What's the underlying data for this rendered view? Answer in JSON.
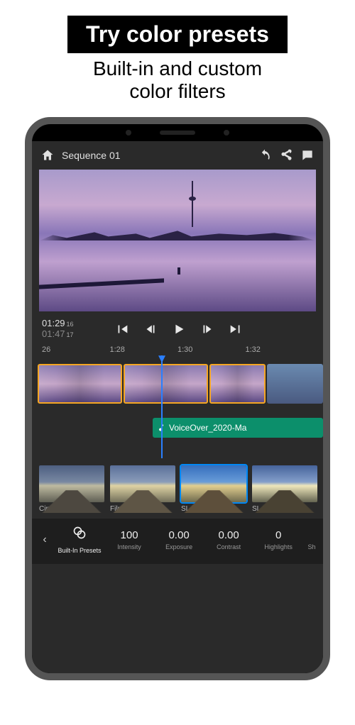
{
  "promo": {
    "title": "Try color presets",
    "subtitle_l1": "Built-in and custom",
    "subtitle_l2": "color filters"
  },
  "header": {
    "sequence": "Sequence 01"
  },
  "playback": {
    "time_in": "01:29",
    "time_in_frames": "16",
    "time_out": "01:47",
    "time_out_frames": "17"
  },
  "ruler": {
    "t0": "26",
    "t1": "1:28",
    "t2": "1:30",
    "t3": "1:32"
  },
  "audio": {
    "clip_name": "VoiceOver_2020-Ma"
  },
  "presets": [
    {
      "label": "Cinematic"
    },
    {
      "label": "Film"
    },
    {
      "label": "SL Kodak"
    },
    {
      "label": "SL Bleac"
    }
  ],
  "adjust": {
    "builtin": "Built-In Presets",
    "intensity_val": "100",
    "intensity_lbl": "Intensity",
    "exposure_val": "0.00",
    "exposure_lbl": "Exposure",
    "contrast_val": "0.00",
    "contrast_lbl": "Contrast",
    "highlights_val": "0",
    "highlights_lbl": "Highlights",
    "shadows_lbl": "Sh"
  }
}
